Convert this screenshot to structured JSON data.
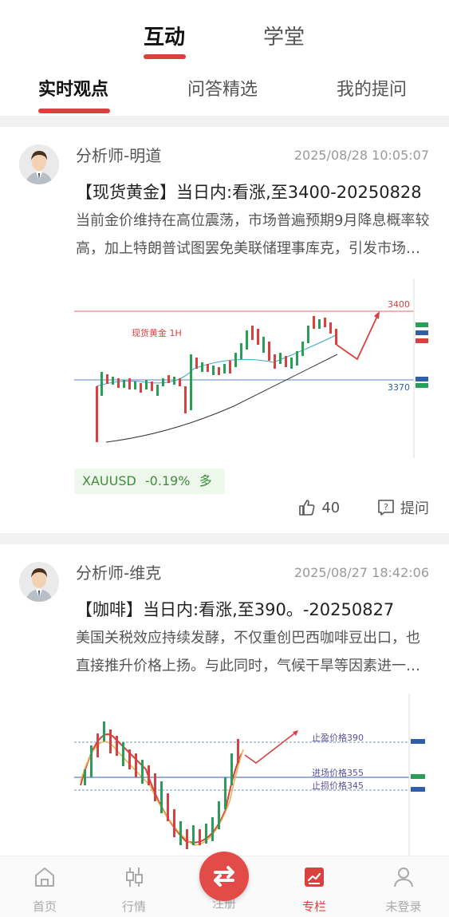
{
  "top_tabs": [
    {
      "label": "互动",
      "active": true
    },
    {
      "label": "学堂",
      "active": false
    }
  ],
  "sub_tabs": [
    {
      "label": "实时观点",
      "active": true
    },
    {
      "label": "问答精选",
      "active": false
    },
    {
      "label": "我的提问",
      "active": false
    }
  ],
  "posts": [
    {
      "author": "分析师-明道",
      "time": "2025/08/28 10:05:07",
      "title": "【现货黄金】当日内:看涨,至3400-20250828",
      "excerpt": "当前金价维持在高位震荡，市场普遍预期9月降息概率较高，加上特朗普试图罢免美联储理事库克，引发市场对美联储独立性的担忧",
      "chart": {
        "label": "现货黄金 1H",
        "level_high": "3400",
        "level_low": "3370"
      },
      "ticker": {
        "symbol": "XAUUSD",
        "change": "-0.19%",
        "direction": "多"
      },
      "likes": "40",
      "ask_label": "提问"
    },
    {
      "author": "分析师-维克",
      "time": "2025/08/27 18:42:06",
      "title": "【咖啡】当日内:看涨,至390。-20250827",
      "excerpt": "美国关税效应持续发酵，不仅重创巴西咖啡豆出口，也直接推升价格上扬。与此同时，气候干旱等因素进一步影响供应",
      "chart": {
        "take_profit": "止盈价格390",
        "entry": "进场价格355",
        "stop_loss": "止损价格345"
      }
    }
  ],
  "bottom_nav": [
    {
      "label": "首页",
      "icon": "home-icon",
      "active": false
    },
    {
      "label": "行情",
      "icon": "candlestick-icon",
      "active": false
    },
    {
      "label": "注册",
      "icon": "swap-icon",
      "active": false
    },
    {
      "label": "专栏",
      "icon": "column-icon",
      "active": true
    },
    {
      "label": "未登录",
      "icon": "user-icon",
      "active": false
    }
  ],
  "colors": {
    "accent": "#d8413f",
    "up": "#2a9d59",
    "down": "#d8413f",
    "ticker_bg": "#edf7ec"
  }
}
